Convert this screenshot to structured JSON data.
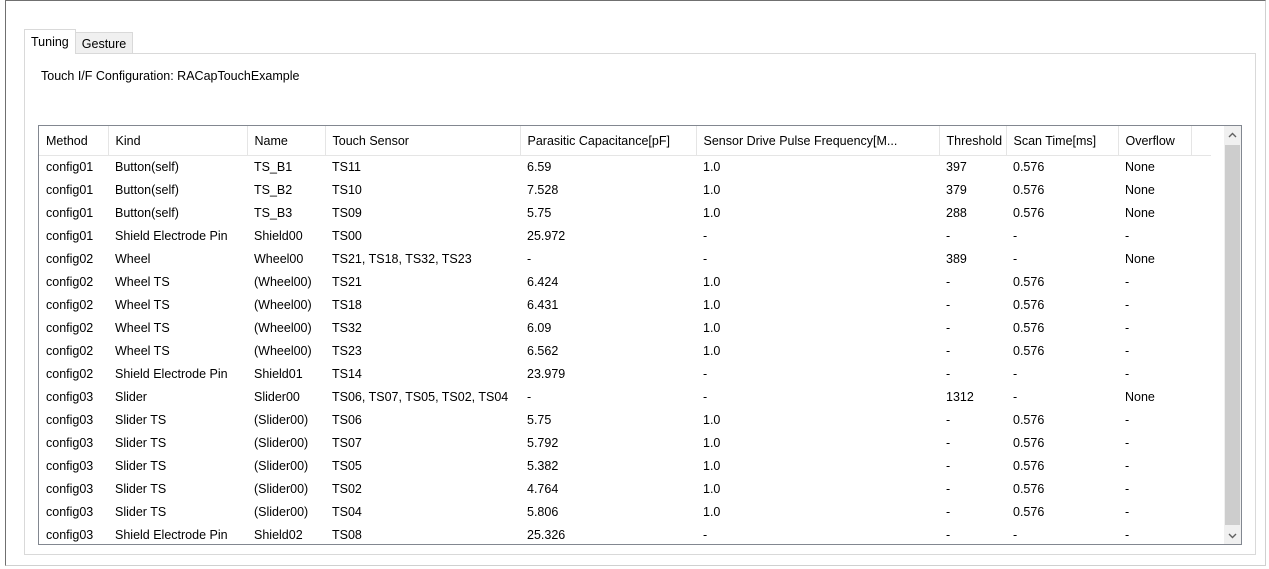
{
  "tabs": [
    {
      "label": "Tuning",
      "active": true
    },
    {
      "label": "Gesture",
      "active": false
    }
  ],
  "config_label": "Touch I/F Configuration: RACapTouchExample",
  "table": {
    "columns": [
      "Method",
      "Kind",
      "Name",
      "Touch Sensor",
      "Parasitic Capacitance[pF]",
      "Sensor Drive Pulse Frequency[M...",
      "Threshold",
      "Scan Time[ms]",
      "Overflow"
    ],
    "rows": [
      [
        "config01",
        "Button(self)",
        "TS_B1",
        "TS11",
        "6.59",
        "1.0",
        "397",
        "0.576",
        "None"
      ],
      [
        "config01",
        "Button(self)",
        "TS_B2",
        "TS10",
        "7.528",
        "1.0",
        "379",
        "0.576",
        "None"
      ],
      [
        "config01",
        "Button(self)",
        "TS_B3",
        "TS09",
        "5.75",
        "1.0",
        "288",
        "0.576",
        "None"
      ],
      [
        "config01",
        "Shield Electrode Pin",
        "Shield00",
        "TS00",
        "25.972",
        "-",
        "-",
        "-",
        "-"
      ],
      [
        "config02",
        "Wheel",
        "Wheel00",
        "TS21, TS18, TS32, TS23",
        "-",
        "-",
        "389",
        "-",
        "None"
      ],
      [
        "config02",
        "Wheel TS",
        "(Wheel00)",
        "TS21",
        "6.424",
        "1.0",
        "-",
        "0.576",
        "-"
      ],
      [
        "config02",
        "Wheel TS",
        "(Wheel00)",
        "TS18",
        "6.431",
        "1.0",
        "-",
        "0.576",
        "-"
      ],
      [
        "config02",
        "Wheel TS",
        "(Wheel00)",
        "TS32",
        "6.09",
        "1.0",
        "-",
        "0.576",
        "-"
      ],
      [
        "config02",
        "Wheel TS",
        "(Wheel00)",
        "TS23",
        "6.562",
        "1.0",
        "-",
        "0.576",
        "-"
      ],
      [
        "config02",
        "Shield Electrode Pin",
        "Shield01",
        "TS14",
        "23.979",
        "-",
        "-",
        "-",
        "-"
      ],
      [
        "config03",
        "Slider",
        "Slider00",
        "TS06, TS07, TS05, TS02, TS04",
        "-",
        "-",
        "1312",
        "-",
        "None"
      ],
      [
        "config03",
        "Slider TS",
        "(Slider00)",
        "TS06",
        "5.75",
        "1.0",
        "-",
        "0.576",
        "-"
      ],
      [
        "config03",
        "Slider TS",
        "(Slider00)",
        "TS07",
        "5.792",
        "1.0",
        "-",
        "0.576",
        "-"
      ],
      [
        "config03",
        "Slider TS",
        "(Slider00)",
        "TS05",
        "5.382",
        "1.0",
        "-",
        "0.576",
        "-"
      ],
      [
        "config03",
        "Slider TS",
        "(Slider00)",
        "TS02",
        "4.764",
        "1.0",
        "-",
        "0.576",
        "-"
      ],
      [
        "config03",
        "Slider TS",
        "(Slider00)",
        "TS04",
        "5.806",
        "1.0",
        "-",
        "0.576",
        "-"
      ],
      [
        "config03",
        "Shield Electrode Pin",
        "Shield02",
        "TS08",
        "25.326",
        "-",
        "-",
        "-",
        "-"
      ]
    ]
  },
  "icons": {
    "scroll_up": "chevron-up-icon",
    "scroll_down": "chevron-down-icon"
  }
}
